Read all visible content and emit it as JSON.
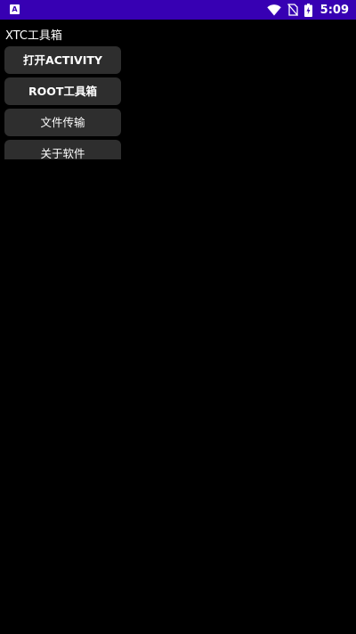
{
  "status_bar": {
    "time": "5:09",
    "left_icon": "A",
    "icons": [
      "wifi-icon",
      "no-sim-icon",
      "battery-icon"
    ],
    "color": "#3700b3"
  },
  "app": {
    "title": "XTC工具箱"
  },
  "buttons": [
    {
      "label": "打开ACTIVITY"
    },
    {
      "label": "ROOT工具箱"
    },
    {
      "label": "文件传输"
    },
    {
      "label": "关于软件"
    }
  ],
  "colors": {
    "background": "#000000",
    "button": "#2e2e2e",
    "text": "#ffffff"
  }
}
